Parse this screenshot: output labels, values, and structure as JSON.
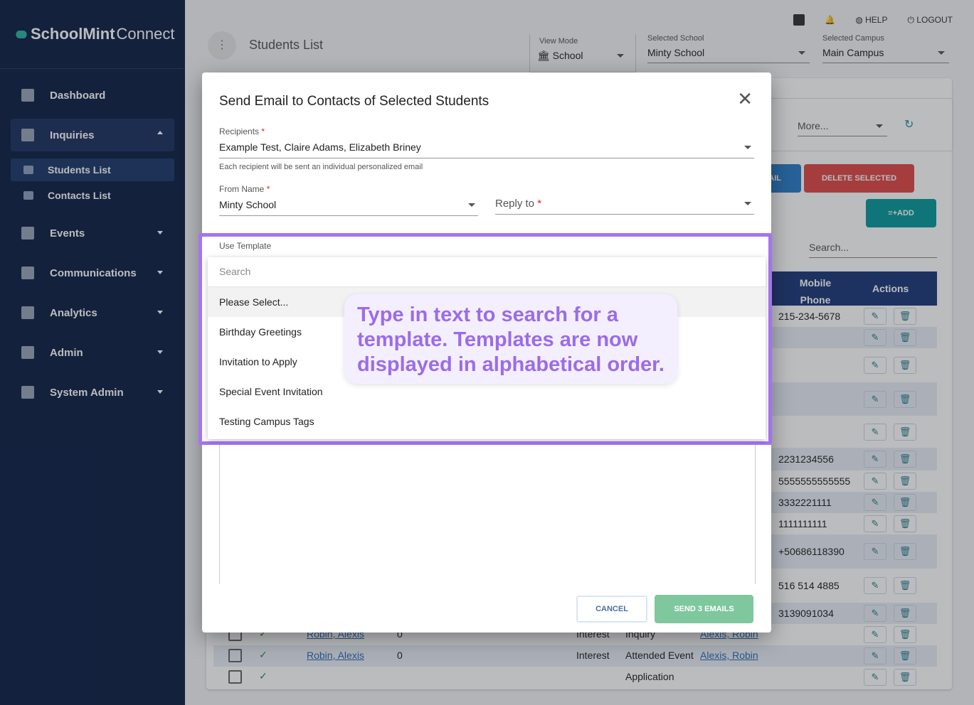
{
  "app": {
    "brand_bold": "SchoolMint",
    "brand_light": "Connect"
  },
  "sidebar": {
    "items": [
      {
        "label": "Dashboard",
        "icon": "dashboard-icon"
      },
      {
        "label": "Inquiries",
        "icon": "person-icon",
        "open": true
      },
      {
        "label": "Events",
        "icon": "calendar-icon"
      },
      {
        "label": "Communications",
        "icon": "chat-icon"
      },
      {
        "label": "Analytics",
        "icon": "chart-icon"
      },
      {
        "label": "Admin",
        "icon": "gear-icon"
      },
      {
        "label": "System Admin",
        "icon": "gear-icon"
      }
    ],
    "subitems": [
      {
        "label": "Students List",
        "active": true
      },
      {
        "label": "Contacts List"
      }
    ]
  },
  "topbar": {
    "help": "HELP",
    "logout": "LOGOUT"
  },
  "header": {
    "title": "Students List",
    "view_mode_label": "View Mode",
    "view_mode": "School",
    "school_label": "Selected School",
    "school": "Minty School",
    "campus_label": "Selected Campus",
    "campus": "Main Campus"
  },
  "page": {
    "more": "More...",
    "email_partial": "AIL",
    "delete": "DELETE SELECTED",
    "add": "ADD",
    "search_placeholder": "Search...",
    "col_mobile": "Mobile Phone",
    "col_actions": "Actions",
    "rows": [
      {
        "phone": "215-234-5678"
      },
      {
        "phone": ""
      },
      {
        "phone": ""
      },
      {
        "phone": ""
      },
      {
        "phone": ""
      },
      {
        "phone": "2231234556"
      },
      {
        "phone": "5555555555555"
      },
      {
        "phone": "3332221111"
      },
      {
        "phone": "1111111111"
      },
      {
        "phone": "+50686118390"
      },
      {
        "phone": "516 514 4885"
      },
      {
        "phone": "3139091034"
      }
    ],
    "bottom_rows": [
      {
        "name": "Robin, Alexis",
        "num": "0",
        "status": "Interest",
        "stage": "Inquiry",
        "contact": "Alexis, Robin"
      },
      {
        "name": "Robin, Alexis",
        "num": "0",
        "status": "Interest",
        "stage": "Attended Event",
        "contact": "Alexis, Robin"
      },
      {
        "stage": "Application"
      }
    ]
  },
  "modal": {
    "title": "Send Email to Contacts of Selected Students",
    "recipients_label": "Recipients",
    "recipients": "Example Test, Claire Adams, Elizabeth Briney",
    "recipients_hint": "Each recipient will be sent an individual personalized email",
    "from_label": "From Name",
    "from": "Minty School",
    "reply_label": "Reply to",
    "template_label": "Use Template",
    "template_search": "Search",
    "template_options": [
      "Please Select...",
      "Birthday Greetings",
      "Invitation to Apply",
      "Special Event Invitation",
      "Testing Campus Tags"
    ],
    "cancel": "CANCEL",
    "send": "SEND 3 EMAILS"
  },
  "callout": {
    "text": "Type in text to search for a template. Templates are now displayed in alphabetical order."
  },
  "colors": {
    "sidebar": "#0f2147",
    "highlight": "#a475ef",
    "delete": "#e04a4a",
    "add": "#0a9a9c",
    "send": "#7fc79d",
    "table_header": "#1f3a7a"
  }
}
